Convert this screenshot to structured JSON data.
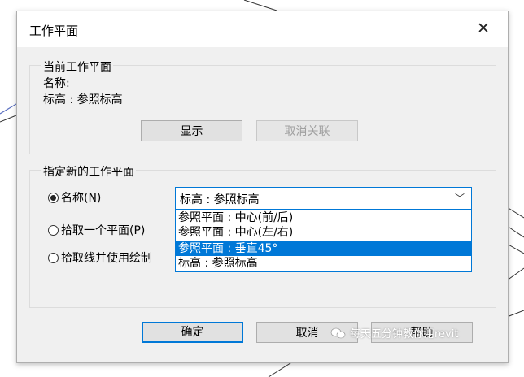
{
  "dialog": {
    "title": "工作平面",
    "close_glyph": "✕"
  },
  "current_plane": {
    "legend": "当前工作平面",
    "name_label": "名称:",
    "name_value": "标高 : 参照标高",
    "show_button": "显示",
    "dissociate_button": "取消关联"
  },
  "new_plane": {
    "legend": "指定新的工作平面",
    "options": [
      {
        "label": "名称(N)",
        "selected": true
      },
      {
        "label": "拾取一个平面(P)",
        "selected": false
      },
      {
        "label": "拾取线并使用绘制",
        "selected": false
      }
    ],
    "combo_value": "标高 : 参照标高",
    "combo_arrow": "﹀",
    "dropdown_items": [
      "参照平面 : 中心(前/后)",
      "参照平面 : 中心(左/右)",
      "参照平面 : 垂直45°",
      "标高 : 参照标高"
    ],
    "highlighted_index": 2
  },
  "footer": {
    "ok_button": "确定",
    "cancel_button": "取消",
    "help_button": "帮助"
  },
  "watermark": "每天五分钟教你用revit",
  "colors": {
    "accent": "#0078d7",
    "dialog_bg": "#f0f0f0"
  }
}
